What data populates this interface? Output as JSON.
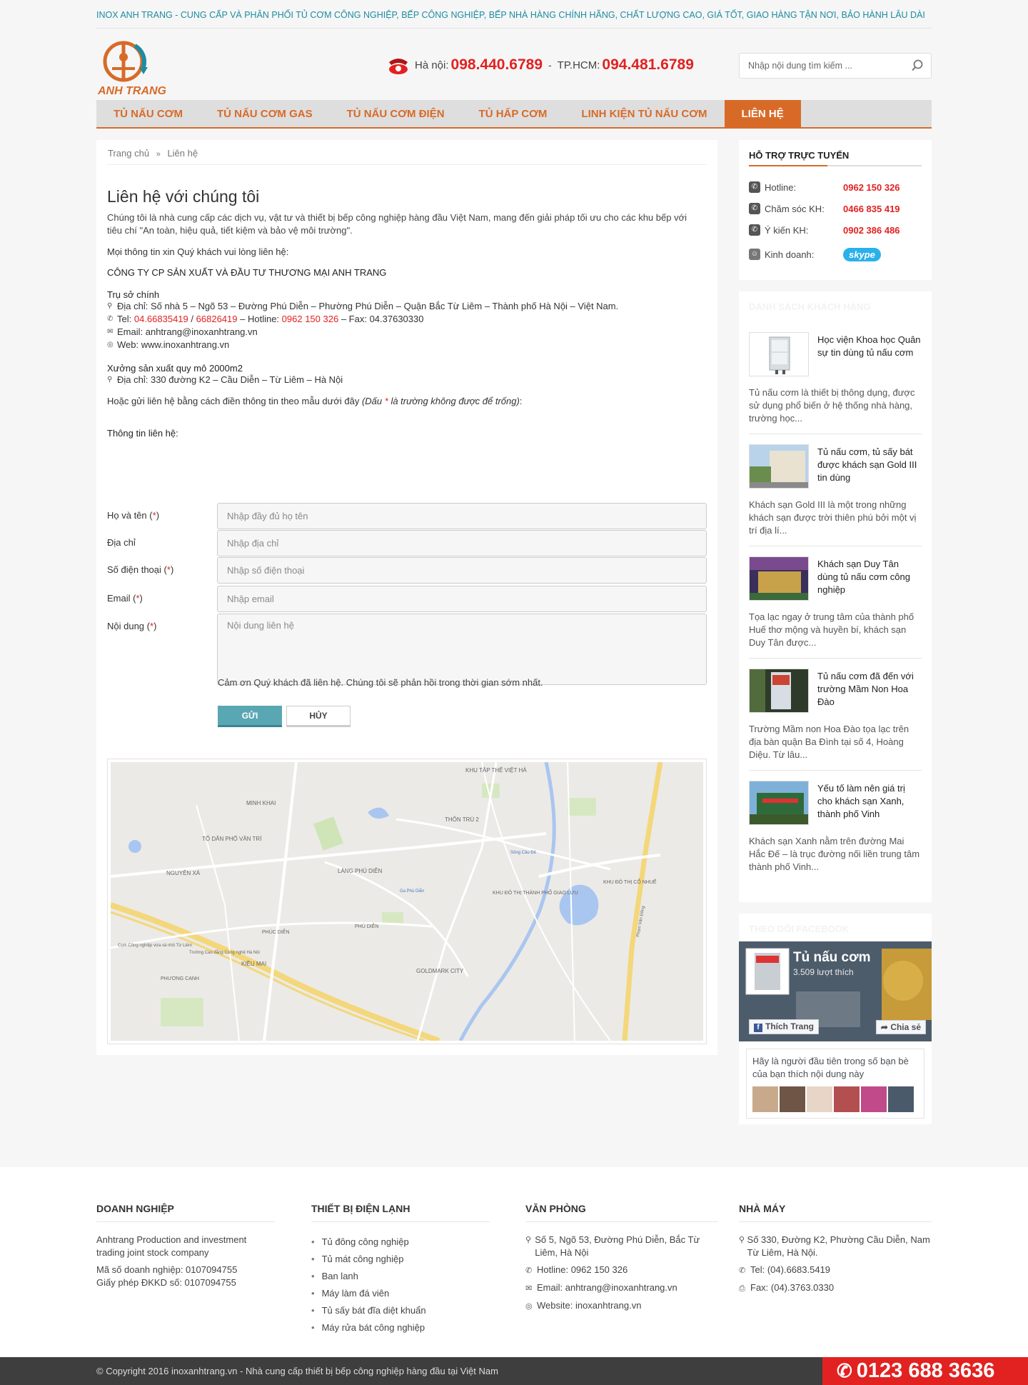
{
  "tagline": "INOX ANH TRANG - CUNG CẤP VÀ PHÂN PHỐI TỦ CƠM CÔNG NGHIỆP, BẾP CÔNG NGHIỆP, BẾP NHÀ HÀNG CHÍNH HÃNG, CHẤT LƯỢNG CAO, GIÁ TỐT, GIAO HÀNG TẬN NƠI, BẢO HÀNH LÂU DÀI",
  "logo_text": "ANH TRANG",
  "hotline": {
    "hanoi_label": "Hà nội:",
    "hanoi_num": "098.440.6789",
    "separator": "-",
    "hcm_label": "TP.HCM:",
    "hcm_num": "094.481.6789"
  },
  "search": {
    "placeholder": "Nhập nội dung tìm kiếm ..."
  },
  "nav": [
    {
      "label": "TỦ NẤU CƠM"
    },
    {
      "label": "TỦ NẤU CƠM GAS"
    },
    {
      "label": "TỦ NẤU CƠM ĐIỆN"
    },
    {
      "label": "TỦ HẤP CƠM"
    },
    {
      "label": "LINH KIỆN TỦ NẤU CƠM"
    },
    {
      "label": "LIÊN HỆ"
    }
  ],
  "breadcrumb": {
    "home": "Trang chủ",
    "sep": "»",
    "current": "Liên hệ"
  },
  "page_title": "Liên hệ với chúng tôi",
  "intro": "Chúng tôi là nhà cung cấp các dịch vụ, vật tư và thiết bị bếp công nghiệp hàng đầu Việt Nam, mang đến giải pháp tối ưu cho các khu bếp với tiêu chí \"An toàn, hiệu quả, tiết kiệm và bảo vệ môi trường\".",
  "contact_lead": "Mọi thông tin xin Quý khách vui lòng liên hệ:",
  "company_name": "CÔNG TY CP SẢN XUẤT VÀ ĐẦU TƯ THƯƠNG MẠI ANH TRANG",
  "head_office": {
    "title": "Trụ sở chính",
    "address": "Địa chỉ: Số nhà 5 – Ngõ 53 – Đường Phú Diễn – Phường Phú Diễn – Quận Bắc Từ Liêm – Thành phố Hà Nội – Việt Nam.",
    "tel_label": "Tel:",
    "tel1": "04.66835419",
    "tel_sep": "/",
    "tel2": "66826419",
    "hotline_label": "– Hotline:",
    "hotline": "0962 150 326",
    "fax": "– Fax: 04.37630330",
    "email": "Email: anhtrang@inoxanhtrang.vn",
    "web": "Web: www.inoxanhtrang.vn"
  },
  "factory": {
    "title": "Xưởng sản xuất quy mô 2000m2",
    "address": "Địa chỉ: 330 đường K2 – Cầu Diễn – Từ Liêm – Hà Nội"
  },
  "form_note_prefix": "Hoặc gửi liên hệ bằng cách điền thông tin theo mẫu dưới đây",
  "form_note_italic_a": "(Dấu",
  "form_note_star": "*",
  "form_note_italic_b": "là trường không được để trống)",
  "form_note_suffix": ":",
  "form": {
    "title": "Thông tin liên hệ:",
    "name_label": "Họ và tên",
    "name_placeholder": "Nhập đầy đủ họ tên",
    "address_label": "Địa chỉ",
    "address_placeholder": "Nhập địa chỉ",
    "phone_label": "Số điện thoại",
    "phone_placeholder": "Nhập số điện thoại",
    "email_label": "Email",
    "email_placeholder": "Nhập email",
    "content_label": "Nội dung",
    "content_placeholder": "Nội dung liên hệ",
    "required_mark": "*",
    "paren_open": "(",
    "paren_close": ")",
    "thanks": "Cảm ơn Quý khách đã liên hệ. Chúng tôi sẽ phản hồi trong thời gian sớm nhất.",
    "send": "GỬI",
    "cancel": "HỦY"
  },
  "map_labels": {
    "khu_tap_the": "KHU TẬP THỂ VIỆT HÀ",
    "minh_khai": "MINH KHAI",
    "thon_tru": "THÔN TRÙ 2",
    "to_dan_pho": "TỔ DÂN PHỐ VĂN TRÌ",
    "nguyen_xa": "NGUYÊN XÁ",
    "lang_phu_dien": "LÀNG PHÚ DIỄN",
    "khu_do_thi_giao_luu": "KHU ĐÔ THỊ THÀNH PHỐ GIAO LƯU",
    "khu_do_thi_co_nhue": "KHU ĐÔ THỊ CỔ NHUẾ",
    "phu_dien": "PHÚ DIỄN",
    "phuc_dien": "PHÚC DIỄN",
    "kieu_mai": "KIỀU MAI",
    "phuong_canh": "PHƯƠNG CANH",
    "goldmark": "GOLDMARK CITY",
    "song_cau_de": "Sông Cầu Đế",
    "pham_van_dong": "Phạm Văn Đồng",
    "ga_phu_dien": "Ga Phú Diễn",
    "cum_cong_nghiep": "Cụm Công nghiệp vừa và nhỏ Từ Liêm",
    "truong_cao_dang": "Trường Cao đẳng Công nghệ Hà Nội"
  },
  "support": {
    "title": "HỖ TRỢ TRỰC TUYẾN",
    "rows": [
      {
        "name": "Hotline:",
        "num": "0962 150 326"
      },
      {
        "name": "Chăm sóc KH:",
        "num": "0466 835 419"
      },
      {
        "name": "Ý kiến KH:",
        "num": "0902 386 486"
      }
    ],
    "sales_label": "Kinh doanh:",
    "skype": "skype"
  },
  "customers": {
    "title": "DANH SÁCH KHÁCH HÀNG",
    "items": [
      {
        "name": "Học viện Khoa học Quân sự tin dùng tủ nấu cơm",
        "desc": "Tủ nấu cơm là thiết bị thông dụng, được sử dụng phổ biến ở hệ thống nhà hàng, trường học..."
      },
      {
        "name": "Tủ nấu cơm, tủ sấy bát được khách sạn Gold III tin dùng",
        "desc": "Khách sạn Gold III là một trong những khách sạn được trời thiên phú bởi một vị trí địa lí..."
      },
      {
        "name": "Khách sạn Duy Tân dùng tủ nấu cơm công nghiệp",
        "desc": "Tọa lạc ngay ở trung tâm của thành phố Huế thơ mộng và huyền bí, khách sạn Duy Tân được..."
      },
      {
        "name": "Tủ nấu cơm đã đến với trường Mầm Non Hoa Đào",
        "desc": "Trường Mầm non Hoa Đào tọa lạc trên địa bàn quận Ba Đình tại số 4, Hoàng Diệu. Từ lâu..."
      },
      {
        "name": "Yếu tố làm nên giá trị cho khách sạn Xanh, thành phố Vinh",
        "desc": "Khách sạn Xanh nằm trên đường Mai Hắc Đế – là trục đường nối liền trung tâm thành phố Vinh..."
      }
    ]
  },
  "facebook": {
    "title": "THEO DÕI FACEBOOK",
    "page_name": "Tủ nấu cơm",
    "likes": "3.509 lượt thích",
    "like_btn": "Thích Trang",
    "share_btn": "Chia sẻ",
    "friends_text": "Hãy là người đầu tiên trong số bạn bè của bạn thích nội dung này"
  },
  "footer": {
    "col1": {
      "title": "DOANH NGHIỆP",
      "lines": [
        "Anhtrang Production and investment trading joint stock company",
        "Mã số doanh nghiệp: 0107094755",
        "Giấy phép ĐKKD số: 0107094755"
      ]
    },
    "col2": {
      "title": "THIẾT BỊ ĐIỆN LẠNH",
      "items": [
        "Tủ đông công nghiệp",
        "Tủ mát công nghiệp",
        "Ban lanh",
        "Máy làm đá viên",
        "Tủ sấy bát đĩa diệt khuẩn",
        "Máy rửa bát công nghiệp"
      ]
    },
    "col3": {
      "title": "VĂN PHÒNG",
      "address": "Số 5, Ngõ 53, Đường Phú Diễn, Bắc Từ Liêm, Hà Nội",
      "hotline": "Hotline: 0962 150 326",
      "email": "Email: anhtrang@inoxanhtrang.vn",
      "website": "Website: inoxanhtrang.vn"
    },
    "col4": {
      "title": "NHÀ MÁY",
      "address": "Số 330, Đường K2, Phường Cầu Diễn, Nam Từ Liêm, Hà Nội.",
      "tel": "Tel: (04).6683.5419",
      "fax": "Fax: (04).3763.0330"
    }
  },
  "copyright": "© Copyright 2016 inoxanhtrang.vn - Nhà cung cấp thiết bị bếp công nghiệp hàng đầu tại Việt Nam",
  "hot_badge": "0123 688 3636",
  "colors": {
    "brand": "#d86a28",
    "teal": "#1d8ca1",
    "red": "#e22121",
    "button": "#5aa7b4"
  }
}
